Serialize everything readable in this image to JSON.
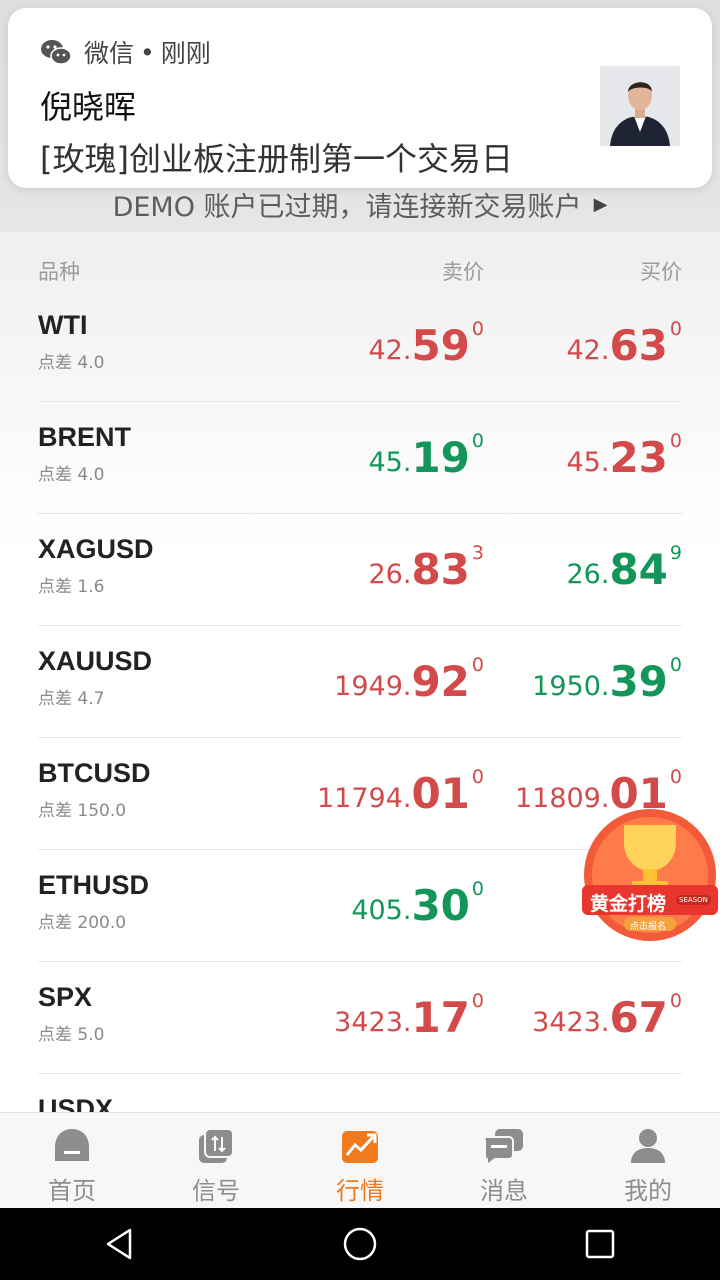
{
  "notification": {
    "app_name": "微信",
    "separator": "•",
    "time": "刚刚",
    "sender": "倪晓晖",
    "message": "[玫瑰]创业板注册制第一个交易日"
  },
  "demo_banner": {
    "text": "DEMO 账户已过期，请连接新交易账户",
    "arrow": "▶"
  },
  "headers": {
    "name": "品种",
    "sell": "卖价",
    "buy": "买价"
  },
  "quotes": [
    {
      "symbol": "WTI",
      "spread": "点差 4.0",
      "sell": {
        "pre": "42.",
        "big": "59",
        "sup": "0",
        "color": "red"
      },
      "buy": {
        "pre": "42.",
        "big": "63",
        "sup": "0",
        "color": "red"
      }
    },
    {
      "symbol": "BRENT",
      "spread": "点差 4.0",
      "sell": {
        "pre": "45.",
        "big": "19",
        "sup": "0",
        "color": "green"
      },
      "buy": {
        "pre": "45.",
        "big": "23",
        "sup": "0",
        "color": "red"
      }
    },
    {
      "symbol": "XAGUSD",
      "spread": "点差 1.6",
      "sell": {
        "pre": "26.",
        "big": "83",
        "sup": "3",
        "color": "red"
      },
      "buy": {
        "pre": "26.",
        "big": "84",
        "sup": "9",
        "color": "green"
      }
    },
    {
      "symbol": "XAUUSD",
      "spread": "点差 4.7",
      "sell": {
        "pre": "1949.",
        "big": "92",
        "sup": "0",
        "color": "red"
      },
      "buy": {
        "pre": "1950.",
        "big": "39",
        "sup": "0",
        "color": "green"
      }
    },
    {
      "symbol": "BTCUSD",
      "spread": "点差 150.0",
      "sell": {
        "pre": "11794.",
        "big": "01",
        "sup": "0",
        "color": "red"
      },
      "buy": {
        "pre": "11809.",
        "big": "01",
        "sup": "0",
        "color": "red"
      }
    },
    {
      "symbol": "ETHUSD",
      "spread": "点差 200.0",
      "sell": {
        "pre": "405.",
        "big": "30",
        "sup": "0",
        "color": "green"
      },
      "buy": {
        "pre": "4",
        "big": "",
        "sup": "",
        "color": "green"
      }
    },
    {
      "symbol": "SPX",
      "spread": "点差 5.0",
      "sell": {
        "pre": "3423.",
        "big": "17",
        "sup": "0",
        "color": "red"
      },
      "buy": {
        "pre": "3423.",
        "big": "67",
        "sup": "0",
        "color": "red"
      }
    },
    {
      "symbol": "USDX",
      "spread": "",
      "sell": {
        "pre": "",
        "big": "",
        "sup": "",
        "color": "red"
      },
      "buy": {
        "pre": "",
        "big": "",
        "sup": "",
        "color": "red"
      }
    }
  ],
  "promo": {
    "title": "黄金打榜",
    "subtitle": "点击报名",
    "tag": "SEASON"
  },
  "tabs": [
    {
      "label": "首页",
      "icon": "home-icon",
      "active": false
    },
    {
      "label": "信号",
      "icon": "signal-icon",
      "active": false
    },
    {
      "label": "行情",
      "icon": "market-chart-icon",
      "active": true
    },
    {
      "label": "消息",
      "icon": "message-icon",
      "active": false
    },
    {
      "label": "我的",
      "icon": "profile-icon",
      "active": false
    }
  ],
  "colors": {
    "red": "#d24a4a",
    "green": "#14965a",
    "accent": "#f07a1e",
    "inactive": "#8d8d8d"
  }
}
